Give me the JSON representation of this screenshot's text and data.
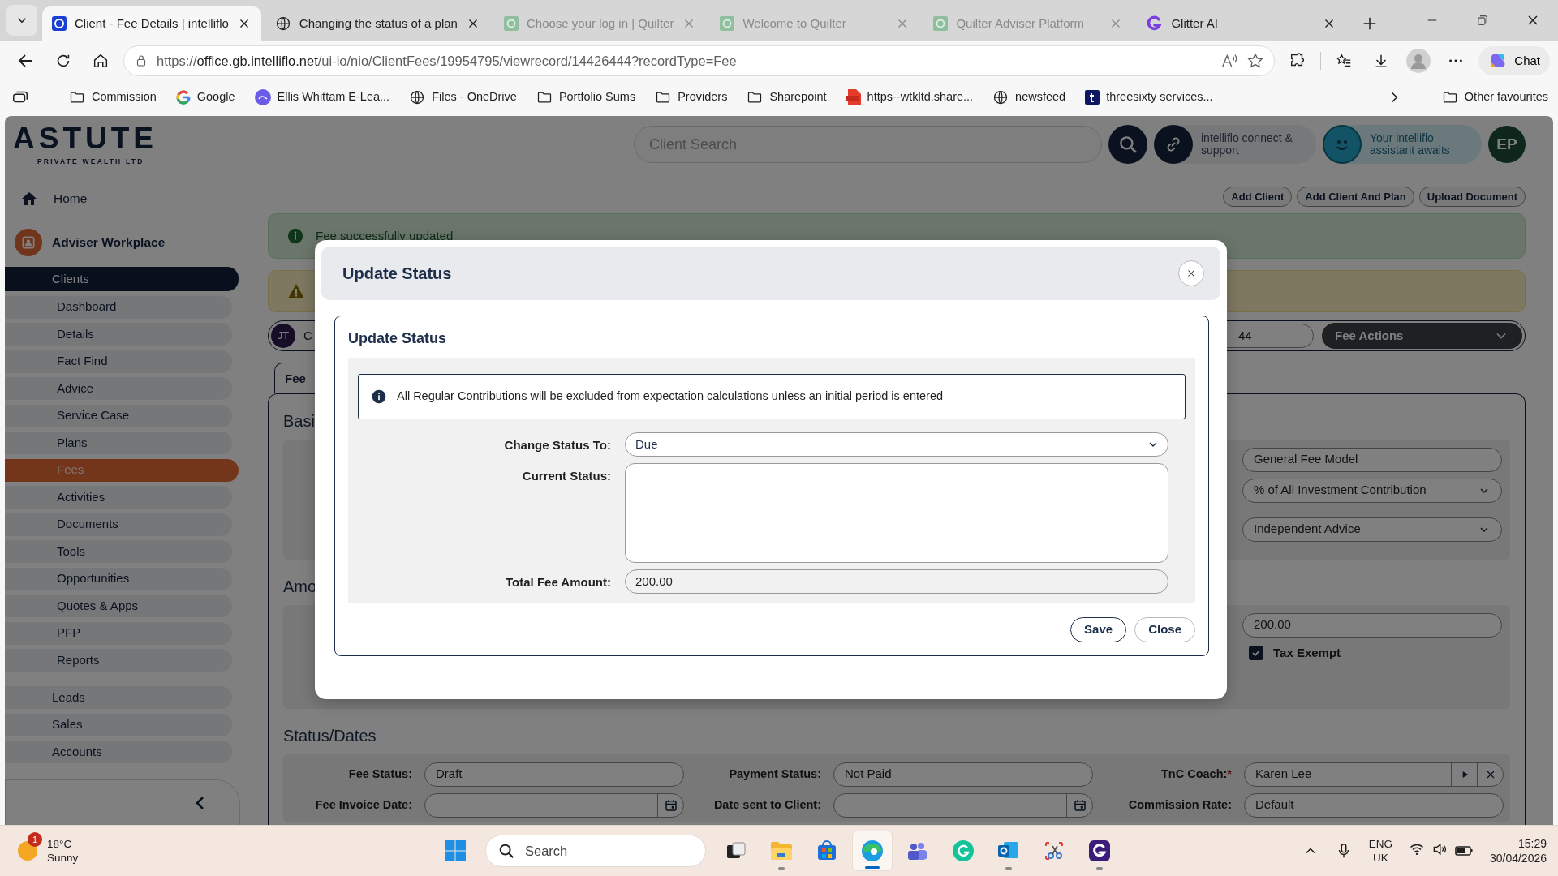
{
  "browser": {
    "tabs": [
      {
        "title": "Client - Fee Details | intelliflo",
        "selected": true,
        "sleeping": false
      },
      {
        "title": "Changing the status of a plan",
        "selected": false,
        "sleeping": false
      },
      {
        "title": "Choose your log in | Quilter",
        "selected": false,
        "sleeping": true
      },
      {
        "title": "Welcome to Quilter",
        "selected": false,
        "sleeping": true
      },
      {
        "title": "Quilter Adviser Platform",
        "selected": false,
        "sleeping": true
      },
      {
        "title": "Glitter AI",
        "selected": false,
        "sleeping": false
      }
    ],
    "address": {
      "scheme": "https://",
      "host": "office.gb.intelliflo.net",
      "path": "/ui-io/nio/ClientFees/19954795/viewrecord/14426444?recordType=Fee"
    },
    "chat_button": "Chat",
    "bookmarks": [
      "Commission",
      "Google",
      "Ellis Whittam E-Lea...",
      "Files - OneDrive",
      "Portfolio Sums",
      "Providers",
      "Sharepoint",
      "https--wtkltd.share...",
      "newsfeed",
      "threesixty services..."
    ],
    "other_favourites": "Other favourites"
  },
  "app": {
    "logo": {
      "name": "ASTUTE",
      "tagline": "PRIVATE WEALTH LTD"
    },
    "sidebar": {
      "home": "Home",
      "workplace": "Adviser Workplace",
      "items": [
        {
          "label": "Clients",
          "selected": true,
          "children": [
            {
              "label": "Dashboard",
              "selected": false
            },
            {
              "label": "Details",
              "selected": false
            },
            {
              "label": "Fact Find",
              "selected": false
            },
            {
              "label": "Advice",
              "selected": false
            },
            {
              "label": "Service Case",
              "selected": false
            },
            {
              "label": "Plans",
              "selected": false
            },
            {
              "label": "Fees",
              "selected": true
            },
            {
              "label": "Activities",
              "selected": false
            },
            {
              "label": "Documents",
              "selected": false
            },
            {
              "label": "Tools",
              "selected": false
            },
            {
              "label": "Opportunities",
              "selected": false
            },
            {
              "label": "Quotes & Apps",
              "selected": false
            },
            {
              "label": "PFP",
              "selected": false
            },
            {
              "label": "Reports",
              "selected": false
            }
          ]
        },
        {
          "label": "Leads",
          "selected": false
        },
        {
          "label": "Sales",
          "selected": false
        },
        {
          "label": "Accounts",
          "selected": false
        }
      ]
    },
    "header": {
      "search_placeholder": "Client Search",
      "connect": "intelliflo connect & support",
      "assistant": "Your intelliflo assistant awaits",
      "avatar": "EP"
    },
    "actions": [
      "Add Client",
      "Add Client And Plan",
      "Upload Document"
    ],
    "alerts": [
      {
        "kind": "success",
        "text": "Fee successfully updated"
      },
      {
        "kind": "warning"
      }
    ],
    "client_bar": {
      "avatar": "JT",
      "name": "C",
      "record": "44",
      "menu": "Fee Actions"
    },
    "tabs": [
      {
        "label": "Fee",
        "selected": true
      }
    ],
    "sections": [
      {
        "title": "Basi",
        "fields": [
          {
            "kind": "text",
            "value": "General Fee Model"
          },
          {
            "kind": "select",
            "value": "% of All Investment Contribution"
          },
          {
            "kind": "select",
            "value": "Independent Advice"
          }
        ]
      },
      {
        "title": "Amo",
        "fields": [
          {
            "kind": "text",
            "value": "200.00"
          },
          {
            "kind": "checkbox",
            "label": "Tax Exempt",
            "checked": true
          }
        ]
      }
    ],
    "status_dates": {
      "title": "Status/Dates",
      "rows": [
        [
          {
            "label": "Fee Status:",
            "kind": "text",
            "value": "Draft"
          },
          {
            "label": "Payment Status:",
            "kind": "text",
            "value": "Not Paid"
          },
          {
            "label": "TnC Coach:",
            "required_mark": "*",
            "kind": "lookup",
            "value": "Karen Lee"
          }
        ],
        [
          {
            "label": "Fee Invoice Date:",
            "kind": "date"
          },
          {
            "label": "Date sent to Client:",
            "kind": "date"
          },
          {
            "label": "Commission Rate:",
            "kind": "text",
            "value": "Default"
          }
        ]
      ]
    }
  },
  "modal": {
    "title": "Update Status",
    "card_title": "Update Status",
    "info": "All Regular Contributions will be excluded from expectation calculations unless an initial period is entered",
    "fields": [
      {
        "label": "Change Status To:",
        "kind": "select",
        "value": "Due"
      },
      {
        "label": "Current Status:",
        "kind": "textarea"
      },
      {
        "label": "Total Fee Amount:",
        "kind": "readonly",
        "value": "200.00"
      }
    ],
    "buttons": [
      {
        "label": "Save",
        "kind": "primary"
      },
      {
        "label": "Close",
        "kind": "secondary"
      }
    ]
  },
  "taskbar": {
    "weather": {
      "temperature": "18°C",
      "condition": "Sunny",
      "badge": "1"
    },
    "search_placeholder": "Search",
    "apps": [
      {
        "running": false,
        "active": false
      },
      {
        "running": true,
        "active": false
      },
      {
        "running": false,
        "active": false
      },
      {
        "running": true,
        "active": true
      },
      {
        "running": false,
        "active": false
      },
      {
        "running": false,
        "active": false
      },
      {
        "running": true,
        "active": false
      },
      {
        "running": false,
        "active": false
      },
      {
        "running": true,
        "active": false
      }
    ],
    "tray": {
      "language": "ENG",
      "region": "UK",
      "time": "15:29",
      "date": "30/04/2026"
    }
  }
}
